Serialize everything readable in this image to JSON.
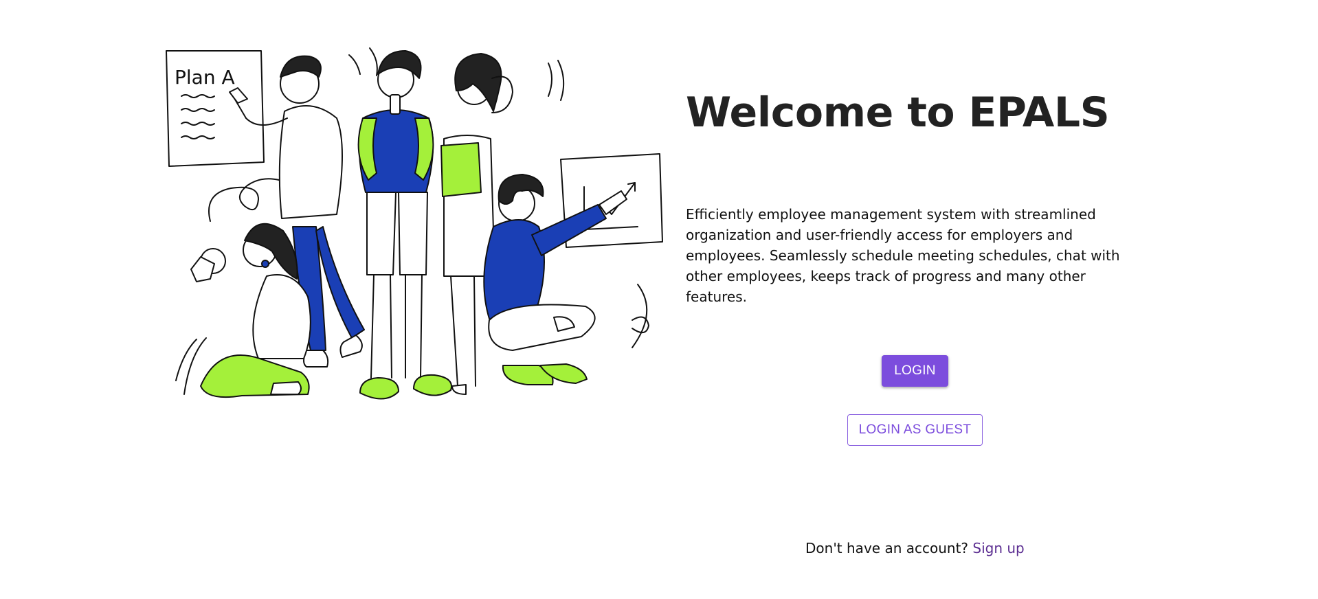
{
  "hero": {
    "illustration_icon": "team-collaboration-illustration",
    "whiteboard_text": "Plan A"
  },
  "main": {
    "title": "Welcome to EPALS",
    "description": "Efficiently employee management system with streamlined organization and user-friendly access for employers and employees. Seamlessly schedule meeting schedules, chat with other employees, keeps track of progress and many other features."
  },
  "actions": {
    "login_label": "LOGIN",
    "guest_label": "LOGIN AS GUEST"
  },
  "footer": {
    "signup_prompt": "Don't have an account?",
    "signup_link": "Sign up"
  },
  "colors": {
    "primary": "#7c4ddd",
    "link": "#5b2d91",
    "accent_green": "#a4f03a",
    "accent_blue": "#1a3fb5"
  }
}
